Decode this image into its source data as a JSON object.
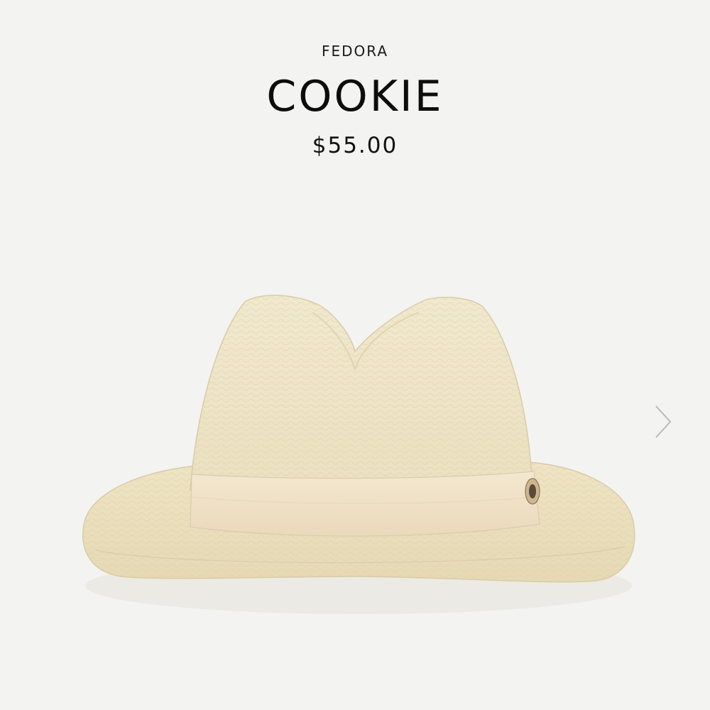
{
  "product": {
    "category": "FEDORA",
    "name": "COOKIE",
    "price": "$55.00"
  },
  "gallery": {
    "next_icon": "chevron-right-icon"
  },
  "colors": {
    "background": "#f3f3f1",
    "straw": "#efe6c8",
    "band": "#f0e2c6"
  }
}
